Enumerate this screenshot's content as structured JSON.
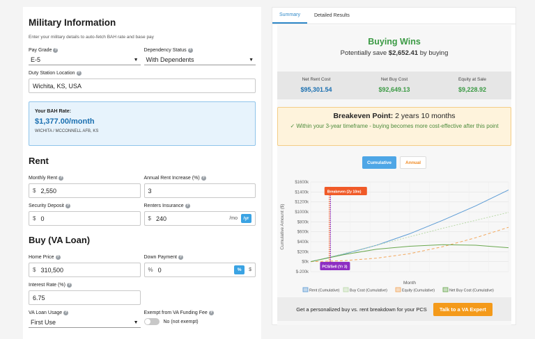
{
  "military": {
    "title": "Military Information",
    "subtitle": "Enter your military details to auto-fetch BAH rate and base pay",
    "pay_grade_label": "Pay Grade",
    "pay_grade_value": "E-5",
    "dependency_label": "Dependency Status",
    "dependency_value": "With Dependents",
    "duty_label": "Duty Station Location",
    "duty_value": "Wichita, KS, USA"
  },
  "bah": {
    "label": "Your BAH Rate:",
    "value": "$1,377.00/month",
    "location": "WICHITA / MCCONNELL AFB, KS"
  },
  "rent": {
    "title": "Rent",
    "monthly_label": "Monthly Rent",
    "monthly_value": "2,550",
    "increase_label": "Annual Rent Increase (%)",
    "increase_value": "3",
    "deposit_label": "Security Deposit",
    "deposit_value": "0",
    "insurance_label": "Renters Insurance",
    "insurance_value": "240",
    "mo": "/mo",
    "yr": "/yr"
  },
  "buy": {
    "title": "Buy (VA Loan)",
    "price_label": "Home Price",
    "price_value": "310,500",
    "down_label": "Down Payment",
    "down_value": "0",
    "pct": "%",
    "dollar": "$",
    "rate_label": "Interest Rate (%)",
    "rate_value": "6.75",
    "usage_label": "VA Loan Usage",
    "usage_value": "First Use",
    "exempt_label": "Exempt from VA Funding Fee",
    "exempt_value": "No (not exempt)"
  },
  "currency_prefix": "$",
  "tabs": [
    "Summary",
    "Detailed Results"
  ],
  "summary": {
    "winner": "Buying Wins",
    "savings_prefix": "Potentially save ",
    "savings_amount": "$2,652.41",
    "savings_suffix": " by buying"
  },
  "stats": [
    {
      "label": "Net Rent Cost",
      "value": "$95,301.54",
      "color": "#1a6fb0"
    },
    {
      "label": "Net Buy Cost",
      "value": "$92,649.13",
      "color": "#3b9a44"
    },
    {
      "label": "Equity at Sale",
      "value": "$9,228.92",
      "color": "#3b9a44"
    }
  ],
  "breakeven": {
    "label": "Breakeven Point:",
    "value": "2 years 10 months",
    "note": "✓ Within your 3-year timeframe - buying becomes more cost-effective after this point"
  },
  "chart_toggle": {
    "cumulative": "Cumulative",
    "annual": "Annual"
  },
  "chart_data": {
    "type": "line",
    "ylabel": "Cumulative Amount ($)",
    "xlabel": "Month",
    "yticks": [
      "$1600k",
      "$1400k",
      "$1200k",
      "$1000k",
      "$800k",
      "$600k",
      "$400k",
      "$200k",
      "$0k",
      "$-200k"
    ],
    "ylim": [
      -200,
      1600
    ],
    "x_range": [
      0,
      30
    ],
    "x_unit": "years",
    "series": [
      {
        "name": "Rent (Cumulative)",
        "color": "#5b9bd5",
        "dash": "",
        "x": [
          0,
          5,
          10,
          15,
          20,
          25,
          30
        ],
        "y": [
          0,
          150,
          330,
          560,
          830,
          1120,
          1440
        ]
      },
      {
        "name": "Buy Cost (Cumulative)",
        "color": "#b9d9a8",
        "dash": "2,2",
        "x": [
          0,
          5,
          10,
          15,
          20,
          25,
          30
        ],
        "y": [
          0,
          160,
          330,
          500,
          670,
          830,
          990
        ]
      },
      {
        "name": "Equity (Cumulative)",
        "color": "#f2a65a",
        "dash": "4,3",
        "x": [
          0,
          5,
          10,
          15,
          20,
          25,
          30
        ],
        "y": [
          0,
          20,
          70,
          160,
          300,
          480,
          690
        ]
      },
      {
        "name": "Net Buy Cost (Cumulative)",
        "color": "#6aa84f",
        "dash": "",
        "x": [
          0,
          5,
          10,
          15,
          20,
          25,
          30
        ],
        "y": [
          0,
          140,
          250,
          310,
          340,
          330,
          280
        ]
      }
    ],
    "annotations": [
      {
        "label": "Breakeven (2y 10m)",
        "x": 2.83,
        "color": "#f05a28"
      },
      {
        "label": "PCS/Sell (Yr 3)",
        "x": 3,
        "color": "#8e2ec2"
      }
    ]
  },
  "cta": {
    "text": "Get a personalized buy vs. rent breakdown for your PCS",
    "button": "Talk to a VA Expert"
  }
}
